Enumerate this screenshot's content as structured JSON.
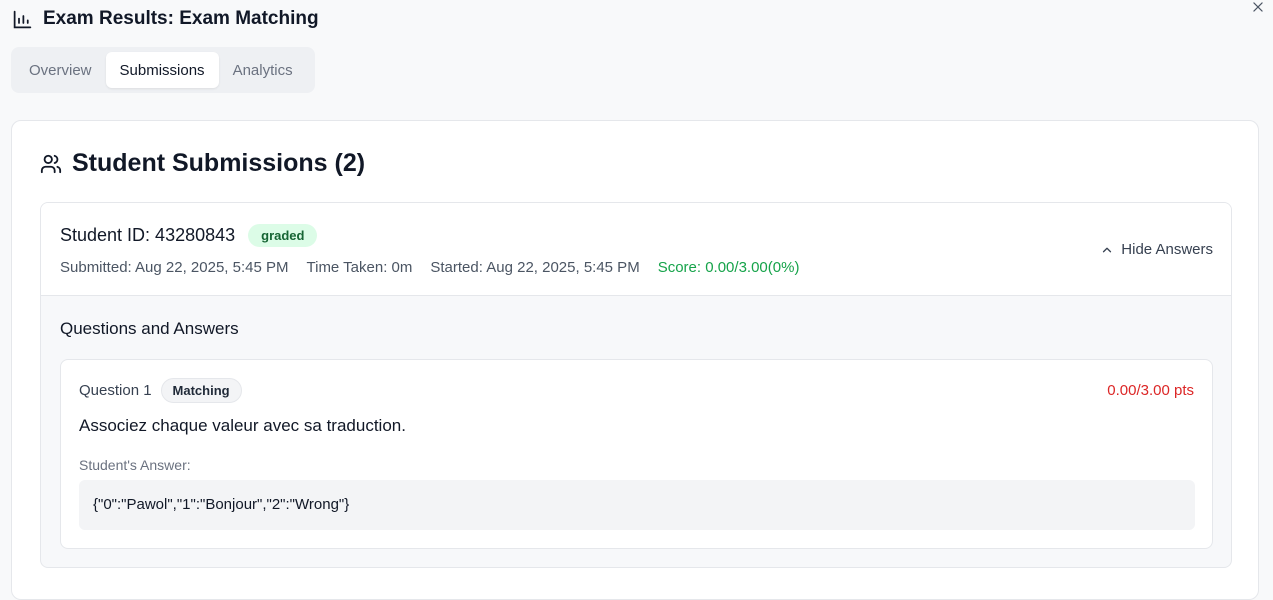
{
  "dialog": {
    "title": "Exam Results: Exam Matching"
  },
  "tabs": [
    {
      "label": "Overview",
      "active": false
    },
    {
      "label": "Submissions",
      "active": true
    },
    {
      "label": "Analytics",
      "active": false
    }
  ],
  "card": {
    "title": "Student Submissions (2)"
  },
  "submission": {
    "student_id": "Student ID: 43280843",
    "status": "graded",
    "submitted": "Submitted: Aug 22, 2025, 5:45 PM",
    "time_taken": "Time Taken: 0m",
    "started": "Started: Aug 22, 2025, 5:45 PM",
    "score": "Score: 0.00/3.00(0%)",
    "toggle_label": "Hide Answers",
    "qa_title": "Questions and Answers",
    "question": {
      "label": "Question 1",
      "type": "Matching",
      "points": "0.00/3.00 pts",
      "text": "Associez chaque valeur avec sa traduction.",
      "answer_label": "Student's Answer:",
      "answer": "{\"0\":\"Pawol\",\"1\":\"Bonjour\",\"2\":\"Wrong\"}"
    }
  },
  "colors": {
    "score_green": "#16a34a",
    "points_red": "#dc2626",
    "graded_bg": "#dcfce7",
    "graded_text": "#166534"
  },
  "icons": {
    "title": "bar-chart-icon",
    "card": "users-icon",
    "toggle": "chevron-up-icon",
    "close": "close-icon"
  }
}
